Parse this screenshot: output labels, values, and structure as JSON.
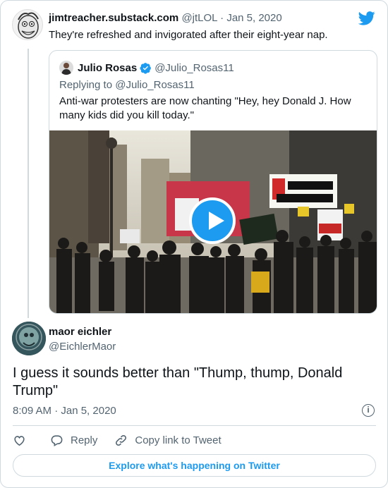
{
  "colors": {
    "accent": "#1d9bf0",
    "text": "#0f1419",
    "muted": "#536471",
    "border": "#cfd9de"
  },
  "parent_tweet": {
    "name": "jimtreacher.substack.com",
    "handle": "@jtLOL",
    "separator": "·",
    "date": "Jan 5, 2020",
    "text": "They're refreshed and invigorated after their eight-year nap."
  },
  "quoted_tweet": {
    "name": "Julio Rosas",
    "verified_icon": "verified-badge-icon",
    "handle": "@Julio_Rosas11",
    "replying_to": "Replying to @Julio_Rosas11",
    "text": "Anti-war protesters are now chanting \"Hey, hey Donald J. How many kids did you kill today.\"",
    "media": {
      "type": "video",
      "play_icon": "play-icon"
    }
  },
  "main_tweet": {
    "name": "maor eichler",
    "handle": "@EichlerMaor",
    "text": "I guess it sounds better than \"Thump, thump, Donald Trump\"",
    "timestamp": "8:09 AM · Jan 5, 2020",
    "info_icon": "i"
  },
  "actions": {
    "like_icon": "heart-icon",
    "reply_icon": "reply-icon",
    "reply_label": "Reply",
    "copy_icon": "link-icon",
    "copy_label": "Copy link to Tweet"
  },
  "footer": {
    "explore_label": "Explore what's happening on Twitter"
  },
  "logo": "twitter-bird-icon"
}
